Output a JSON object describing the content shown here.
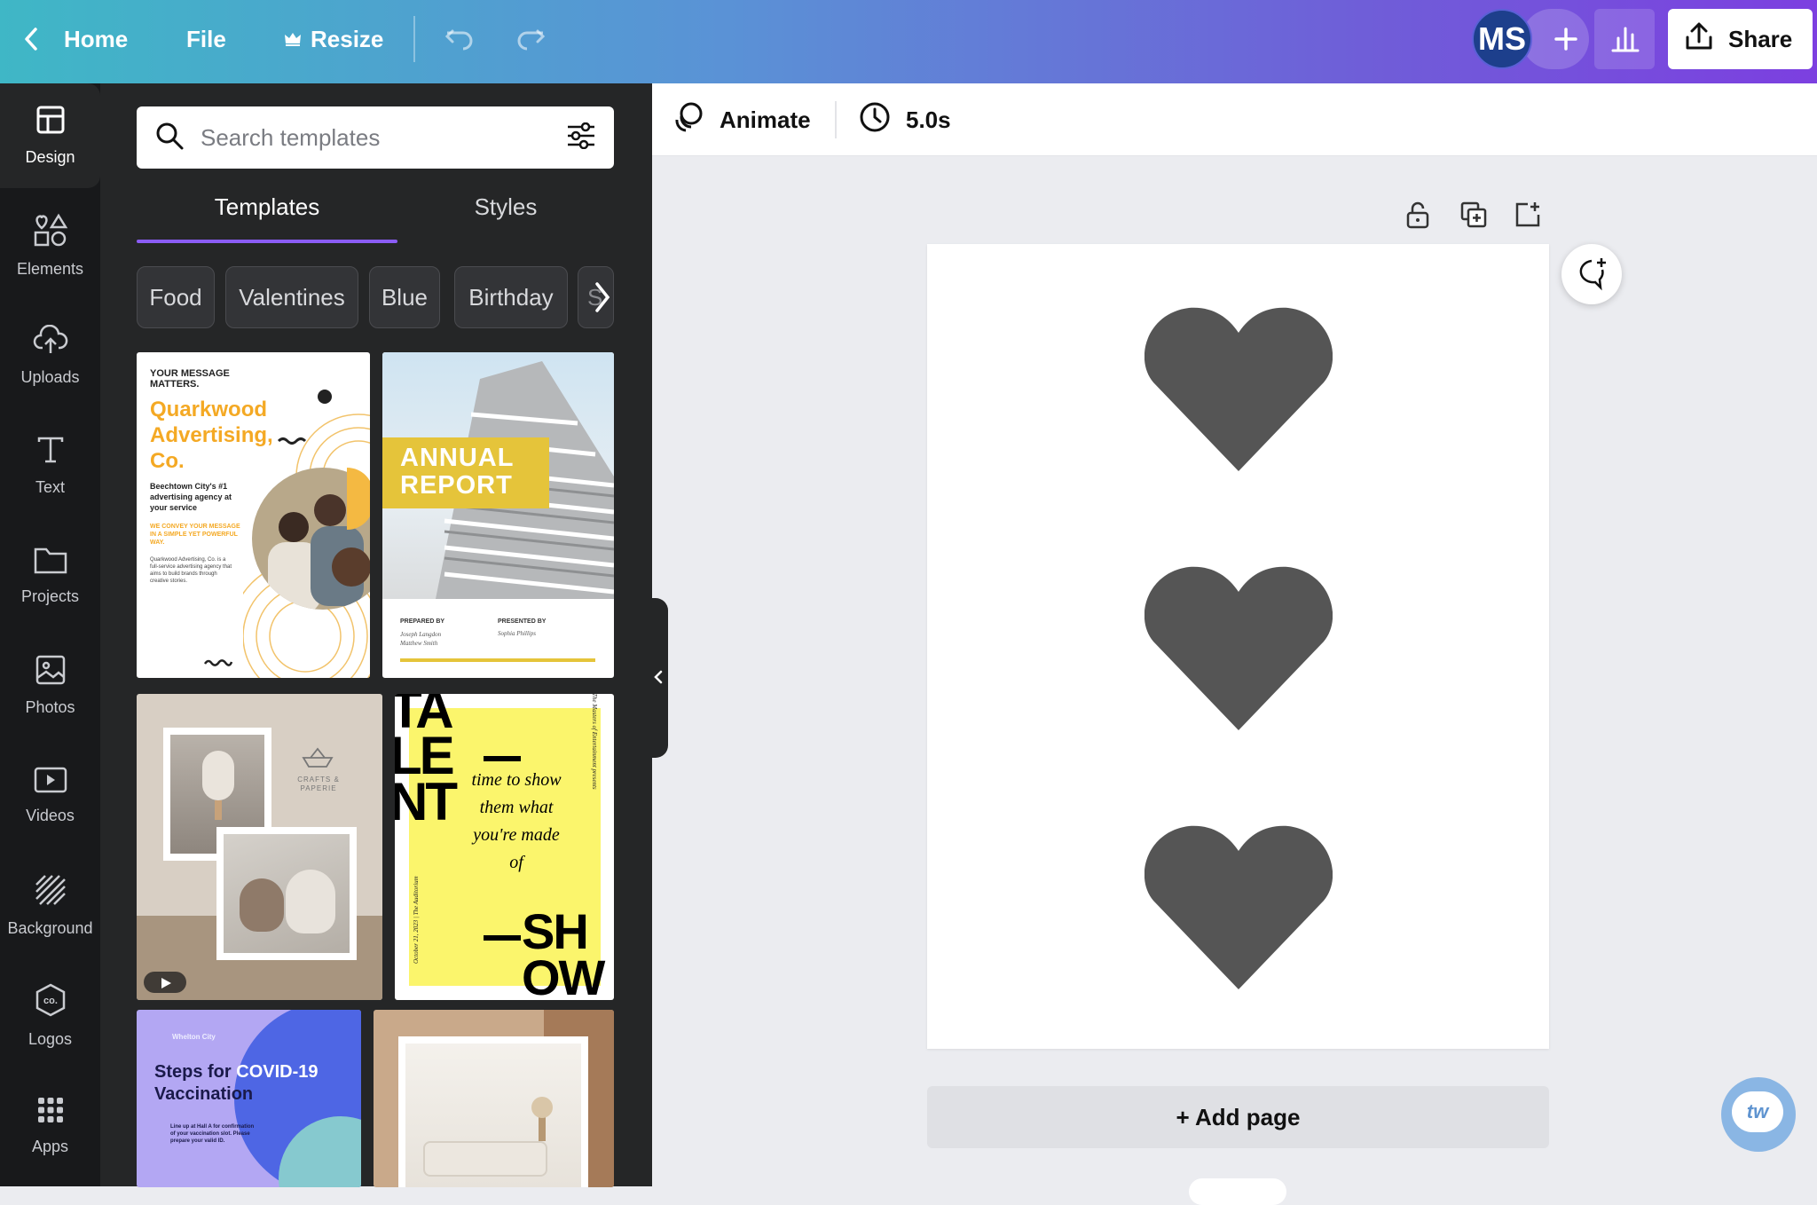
{
  "topbar": {
    "home_label": "Home",
    "file_label": "File",
    "resize_label": "Resize",
    "avatar_initials": "MS",
    "share_label": "Share"
  },
  "leftnav": {
    "items": [
      {
        "label": "Design",
        "icon": "layout-icon"
      },
      {
        "label": "Elements",
        "icon": "shapes-icon"
      },
      {
        "label": "Uploads",
        "icon": "cloud-upload-icon"
      },
      {
        "label": "Text",
        "icon": "text-icon"
      },
      {
        "label": "Projects",
        "icon": "folder-icon"
      },
      {
        "label": "Photos",
        "icon": "image-icon"
      },
      {
        "label": "Videos",
        "icon": "video-icon"
      },
      {
        "label": "Background",
        "icon": "pattern-icon"
      },
      {
        "label": "Logos",
        "icon": "logo-icon"
      },
      {
        "label": "Apps",
        "icon": "apps-grid-icon"
      }
    ]
  },
  "panel": {
    "search_placeholder": "Search templates",
    "tabs": [
      {
        "label": "Templates"
      },
      {
        "label": "Styles"
      }
    ],
    "chips": [
      {
        "label": "Food"
      },
      {
        "label": "Valentines"
      },
      {
        "label": "Blue"
      },
      {
        "label": "Birthday"
      },
      {
        "label": "S"
      }
    ],
    "templates": {
      "t1": {
        "eyebrow": "YOUR MESSAGE MATTERS.",
        "title": "Quarkwood Advertising, Co.",
        "sub": "Beechtown City's #1 advertising agency at your service",
        "tag": "WE CONVEY YOUR MESSAGE IN A SIMPLE YET POWERFUL WAY.",
        "body": "Quarkwood Advertising, Co. is a full-service advertising agency that aims to build brands through creative stories."
      },
      "t2": {
        "title": "ANNUAL REPORT",
        "prepared_label": "PREPARED BY",
        "prepared_names": "Joseph Langdon\nMatthew Smith",
        "presented_label": "PRESENTED BY",
        "presented_name": "Sophia Phillips"
      },
      "t3": {
        "brand": "CRAFTS & PAPERIE"
      },
      "t4": {
        "big": "TA\nLE\nNT",
        "quote": "time to show them what you're made of",
        "show": "SH\nOW",
        "side_text": "The Masters of Entertainment presents",
        "date_text": "October 21, 2023 | The Auditorium"
      },
      "t5": {
        "city": "Whelton City",
        "title_a": "Steps for ",
        "title_b": "COVID-19",
        "title_c": "Vaccination",
        "body": "Line up at Hall A for confirmation of your vaccination slot. Please prepare your valid ID."
      }
    }
  },
  "canvas": {
    "animate_label": "Animate",
    "duration_label": "5.0s",
    "add_page_label": "+ Add page",
    "heart_color": "#555555",
    "help_badge": "tw"
  },
  "colors": {
    "accent": "#8b5cf6",
    "nav_bg": "#18191b",
    "panel_bg": "#252627"
  }
}
